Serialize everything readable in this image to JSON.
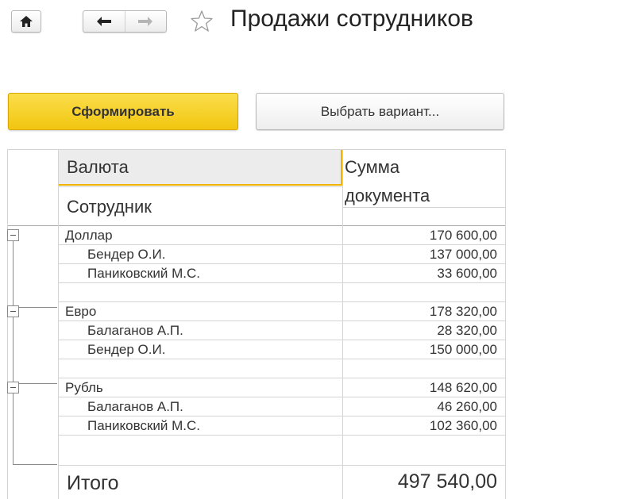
{
  "toolbar": {
    "home_icon": "home-icon",
    "back_icon": "arrow-left-icon",
    "forward_icon": "arrow-right-icon",
    "favorite_icon": "star-icon",
    "title": "Продажи сотрудников"
  },
  "actions": {
    "generate_label": "Сформировать",
    "variant_label": "Выбрать вариант..."
  },
  "report": {
    "header": {
      "currency": "Валюта",
      "employee": "Сотрудник",
      "amount_line1": "Сумма",
      "amount_line2": "документа"
    },
    "groups": [
      {
        "name": "Доллар",
        "total": "170 600,00",
        "rows": [
          {
            "name": "Бендер О.И.",
            "amount": "137 000,00"
          },
          {
            "name": "Паниковский М.С.",
            "amount": "33 600,00"
          }
        ]
      },
      {
        "name": "Евро",
        "total": "178 320,00",
        "rows": [
          {
            "name": "Балаганов А.П.",
            "amount": "28 320,00"
          },
          {
            "name": "Бендер О.И.",
            "amount": "150 000,00"
          }
        ]
      },
      {
        "name": "Рубль",
        "total": "148 620,00",
        "rows": [
          {
            "name": "Балаганов А.П.",
            "amount": "46 260,00"
          },
          {
            "name": "Паниковский М.С.",
            "amount": "102 360,00"
          }
        ]
      }
    ],
    "total_label": "Итого",
    "total_value": "497 540,00"
  },
  "colors": {
    "accent_button": "#f5cb1c",
    "header_highlight": "#ececec",
    "active_underline": "#f0b400"
  }
}
